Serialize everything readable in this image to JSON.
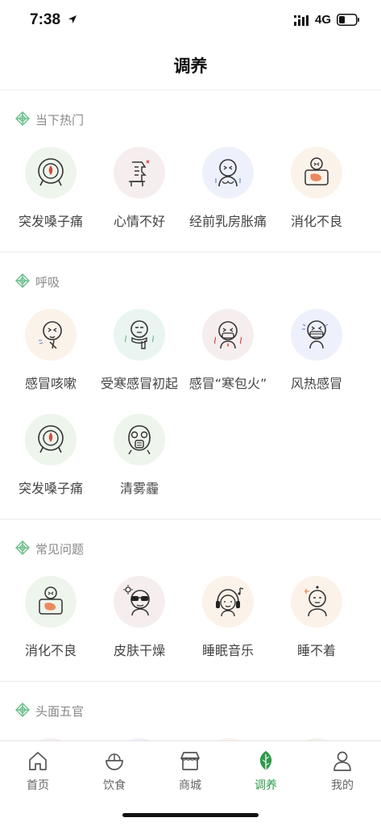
{
  "status": {
    "time": "7:38",
    "network": "4G"
  },
  "nav": {
    "title": "调养"
  },
  "sections": [
    {
      "title": "当下热门",
      "items": [
        {
          "label": "突发嗓子痛",
          "icon": "throat-icon",
          "bg": "#eef5ec"
        },
        {
          "label": "心情不好",
          "icon": "mood-icon",
          "bg": "#f6eeee"
        },
        {
          "label": "经前乳房胀痛",
          "icon": "breast-pain-icon",
          "bg": "#eef1fb"
        },
        {
          "label": "消化不良",
          "icon": "stomach-icon",
          "bg": "#fbf2ea"
        }
      ]
    },
    {
      "title": "呼吸",
      "items": [
        {
          "label": "感冒咳嗽",
          "icon": "cough-icon",
          "bg": "#fbf2ea"
        },
        {
          "label": "受寒感冒初起",
          "icon": "cold-scarf-icon",
          "bg": "#eaf5f2"
        },
        {
          "label": "感冒“寒包火”",
          "icon": "fever-icon",
          "bg": "#f6eeee"
        },
        {
          "label": "风热感冒",
          "icon": "mask-icon",
          "bg": "#eef1fb"
        },
        {
          "label": "突发嗓子痛",
          "icon": "throat-icon",
          "bg": "#eef5ec"
        },
        {
          "label": "清雾霾",
          "icon": "gas-mask-icon",
          "bg": "#eef5ec"
        }
      ]
    },
    {
      "title": "常见问题",
      "items": [
        {
          "label": "消化不良",
          "icon": "stomach-icon",
          "bg": "#eef5ec"
        },
        {
          "label": "皮肤干燥",
          "icon": "sunglasses-icon",
          "bg": "#f6eeee"
        },
        {
          "label": "睡眠音乐",
          "icon": "headphones-icon",
          "bg": "#fbf2ea"
        },
        {
          "label": "睡不着",
          "icon": "sleepless-icon",
          "bg": "#fbf2ea"
        }
      ]
    },
    {
      "title": "头面五官",
      "items": [
        {
          "label": "",
          "icon": "face-icon",
          "bg": "#f6eeee"
        },
        {
          "label": "",
          "icon": "face-icon",
          "bg": "#eef1fb"
        },
        {
          "label": "",
          "icon": "face-icon",
          "bg": "#fbf2ea"
        },
        {
          "label": "",
          "icon": "face-icon",
          "bg": "#eef5ec"
        }
      ]
    }
  ],
  "tabs": [
    {
      "label": "首页",
      "icon": "home-icon"
    },
    {
      "label": "饮食",
      "icon": "food-bowl-icon"
    },
    {
      "label": "商城",
      "icon": "shop-icon"
    },
    {
      "label": "调养",
      "icon": "leaf-icon",
      "active": true
    },
    {
      "label": "我的",
      "icon": "user-icon"
    }
  ],
  "colors": {
    "accent": "#2e9a4c",
    "section_icon": "#6fbf8e",
    "stroke": "#333333",
    "red": "#d64a3e"
  }
}
